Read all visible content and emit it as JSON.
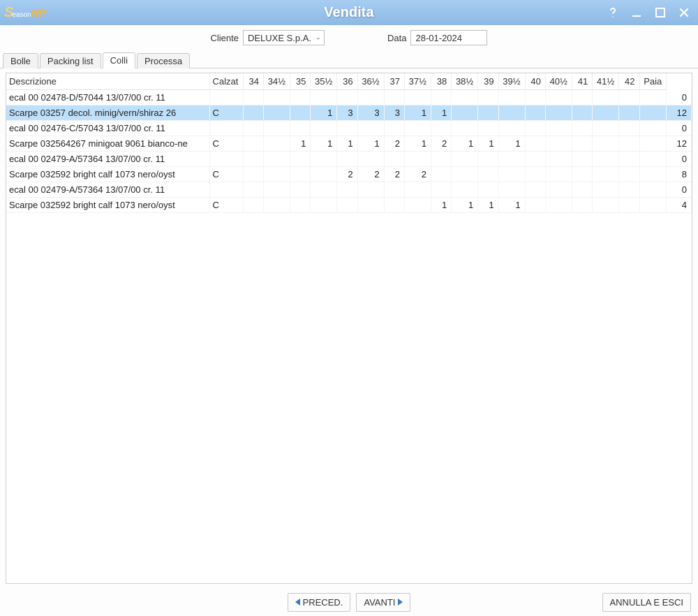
{
  "window": {
    "title": "Vendita",
    "logo_small": "eason"
  },
  "header": {
    "cliente_label": "Cliente",
    "cliente_value": "DELUXE S.p.A.",
    "data_label": "Data",
    "data_value": "28-01-2024"
  },
  "tabs": [
    {
      "label": "Bolle",
      "active": false
    },
    {
      "label": "Packing list",
      "active": false
    },
    {
      "label": "Colli",
      "active": true
    },
    {
      "label": "Processa",
      "active": false
    }
  ],
  "grid": {
    "columns": [
      "Descrizione",
      "Calzat",
      "34",
      "34½",
      "35",
      "35½",
      "36",
      "36½",
      "37",
      "37½",
      "38",
      "38½",
      "39",
      "39½",
      "40",
      "40½",
      "41",
      "41½",
      "42",
      "Paia"
    ],
    "rows": [
      {
        "desc": "ecal 00 02478-D/57044 13/07/00 cr. 11",
        "calz": "",
        "sizes": [
          "",
          "",
          "",
          "",
          "",
          "",
          "",
          "",
          "",
          "",
          "",
          "",
          "",
          "",
          "",
          "",
          "",
          ""
        ],
        "paia": "0",
        "selected": false
      },
      {
        "desc": "Scarpe 03257 decol. minig/vern/shiraz 26",
        "calz": "C",
        "sizes": [
          "",
          "",
          "",
          "1",
          "3",
          "3",
          "3",
          "1",
          "1",
          "",
          "",
          "",
          "",
          "",
          "",
          "",
          "",
          ""
        ],
        "paia": "12",
        "selected": true
      },
      {
        "desc": "ecal 00 02476-C/57043 13/07/00 cr. 11",
        "calz": "",
        "sizes": [
          "",
          "",
          "",
          "",
          "",
          "",
          "",
          "",
          "",
          "",
          "",
          "",
          "",
          "",
          "",
          "",
          "",
          ""
        ],
        "paia": "0",
        "selected": false
      },
      {
        "desc": "Scarpe 032564267 minigoat 9061 bianco-ne",
        "calz": "C",
        "sizes": [
          "",
          "",
          "1",
          "1",
          "1",
          "1",
          "2",
          "1",
          "2",
          "1",
          "1",
          "1",
          "",
          "",
          "",
          "",
          "",
          ""
        ],
        "paia": "12",
        "selected": false
      },
      {
        "desc": "ecal 00 02479-A/57364 13/07/00 cr. 11",
        "calz": "",
        "sizes": [
          "",
          "",
          "",
          "",
          "",
          "",
          "",
          "",
          "",
          "",
          "",
          "",
          "",
          "",
          "",
          "",
          "",
          ""
        ],
        "paia": "0",
        "selected": false
      },
      {
        "desc": "Scarpe 032592 bright calf 1073 nero/oyst",
        "calz": "C",
        "sizes": [
          "",
          "",
          "",
          "",
          "2",
          "2",
          "2",
          "2",
          "",
          "",
          "",
          "",
          "",
          "",
          "",
          "",
          "",
          ""
        ],
        "paia": "8",
        "selected": false
      },
      {
        "desc": "ecal 00 02479-A/57364 13/07/00 cr. 11",
        "calz": "",
        "sizes": [
          "",
          "",
          "",
          "",
          "",
          "",
          "",
          "",
          "",
          "",
          "",
          "",
          "",
          "",
          "",
          "",
          "",
          ""
        ],
        "paia": "0",
        "selected": false
      },
      {
        "desc": "Scarpe 032592 bright calf 1073 nero/oyst",
        "calz": "C",
        "sizes": [
          "",
          "",
          "",
          "",
          "",
          "",
          "",
          "",
          "1",
          "1",
          "1",
          "1",
          "",
          "",
          "",
          "",
          "",
          ""
        ],
        "paia": "4",
        "selected": false
      }
    ]
  },
  "footer": {
    "prev_label": "PRECED.",
    "next_label": "AVANTI",
    "cancel_label": "ANNULLA E ESCI"
  }
}
